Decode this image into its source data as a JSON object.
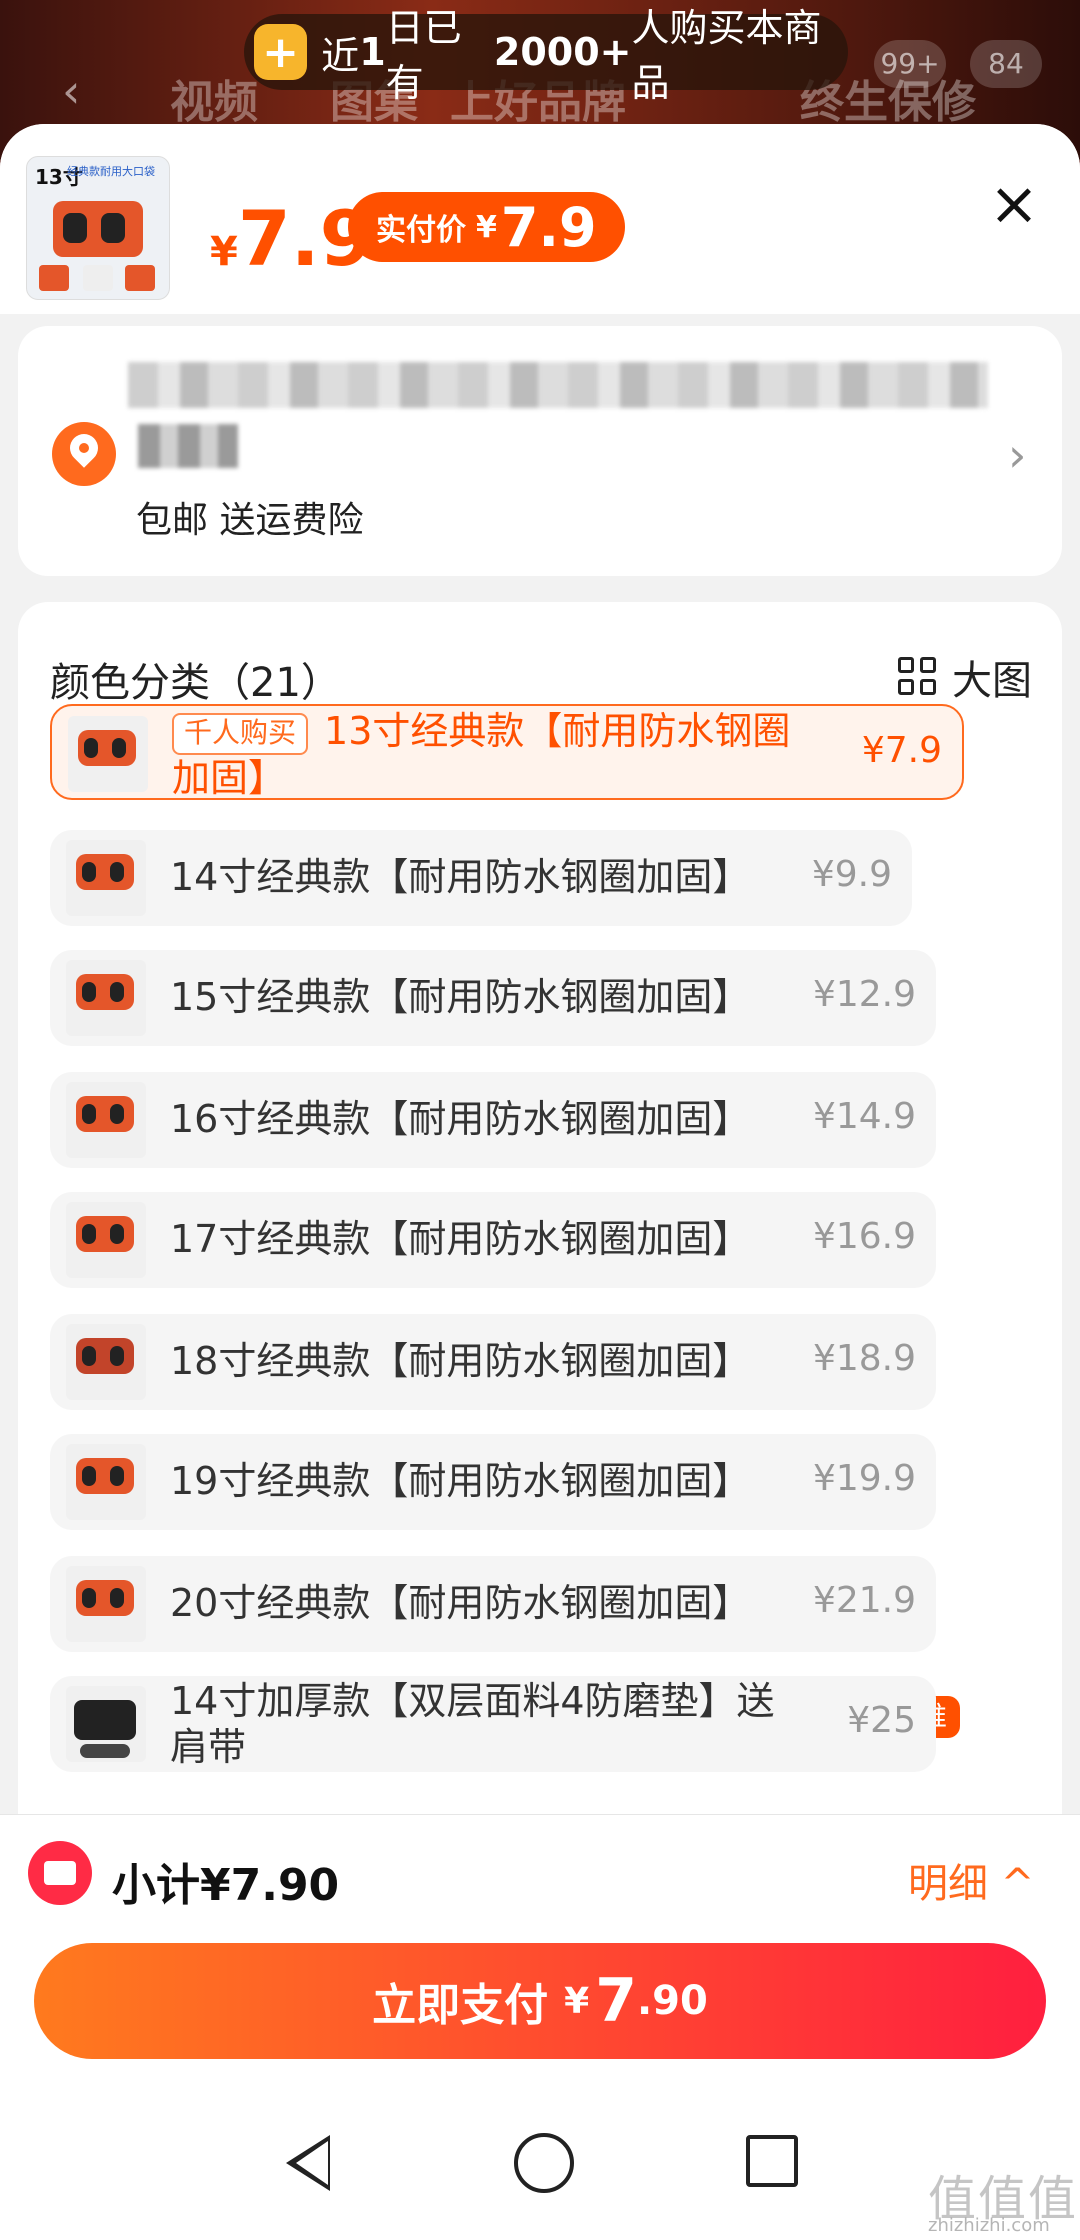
{
  "background": {
    "tabs": [
      "视频",
      "图集",
      "上好品牌",
      "终生保修"
    ],
    "cart_count": "99+",
    "badge": "84"
  },
  "toast": {
    "prefix": "近",
    "days": "1",
    "mid": "日已有",
    "count": "2000+",
    "suffix": "人购买本商品"
  },
  "header": {
    "thumb_size": "13寸",
    "thumb_caption": "经典款耐用大口袋",
    "price_symbol": "¥",
    "price": "7.9",
    "real_price_label": "实付价",
    "real_price_symbol": "¥",
    "real_price": "7.9",
    "close_icon": "close-icon"
  },
  "address": {
    "shipping": "包邮 送运费险"
  },
  "sku": {
    "title": "颜色分类（21）",
    "big_view": "大图",
    "options": [
      {
        "size": "13寸",
        "name": "13寸经典款【耐用防水钢圈加固】",
        "price": "¥7.9",
        "tag": "千人购买",
        "selected": true
      },
      {
        "size": "14寸",
        "name": "14寸经典款【耐用防水钢圈加固】",
        "price": "¥9.9"
      },
      {
        "size": "15寸",
        "name": "15寸经典款【耐用防水钢圈加固】",
        "price": "¥12.9"
      },
      {
        "size": "16寸",
        "name": "16寸经典款【耐用防水钢圈加固】",
        "price": "¥14.9"
      },
      {
        "size": "17寸",
        "name": "17寸经典款【耐用防水钢圈加固】",
        "price": "¥16.9"
      },
      {
        "size": "18寸",
        "name": "18寸经典款【耐用防水钢圈加固】",
        "price": "¥18.9"
      },
      {
        "size": "19寸",
        "name": "19寸经典款【耐用防水钢圈加固】",
        "price": "¥19.9"
      },
      {
        "size": "20寸",
        "name": "20寸经典款【耐用防水钢圈加固】",
        "price": "¥21.9",
        "badge": "主推"
      },
      {
        "size": "14寸",
        "name": "14寸加厚款【双层面料4防磨垫】送肩带",
        "price": "¥25"
      }
    ]
  },
  "footer": {
    "subtotal": "小计¥7.90",
    "detail": "明细 ^",
    "pay_label": "立即支付",
    "pay_symbol": "¥",
    "pay_int": "7",
    "pay_dec": ".90"
  },
  "watermark": {
    "main": "值值值",
    "sub": "zhizhizhi.com"
  },
  "colors": {
    "accent": "#ff5000",
    "pay_gradient_start": "#ff7a1e",
    "pay_gradient_end": "#ff1f3f"
  }
}
